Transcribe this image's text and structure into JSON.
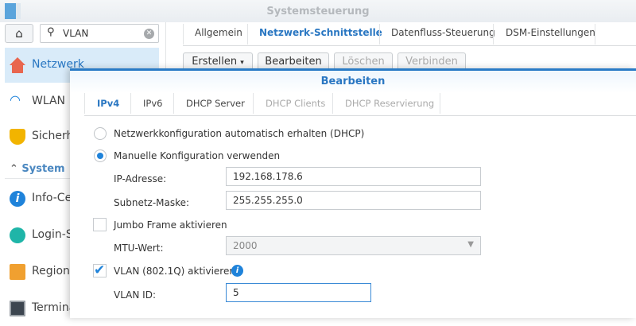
{
  "window": {
    "title": "Systemsteuerung"
  },
  "sidebar": {
    "search_value": "VLAN",
    "items": [
      {
        "label": "Netzwerk",
        "icon": "house-network-icon"
      },
      {
        "label": "WLAN",
        "icon": "wifi-icon"
      },
      {
        "label": "Sicherh",
        "icon": "shield-icon"
      }
    ],
    "section": "System",
    "system_items": [
      {
        "label": "Info-Ce",
        "icon": "info-icon"
      },
      {
        "label": "Login-S",
        "icon": "palette-icon"
      },
      {
        "label": "Regiona",
        "icon": "map-clock-icon"
      },
      {
        "label": "Termina",
        "icon": "terminal-icon"
      }
    ]
  },
  "main": {
    "tabs": [
      "Allgemein",
      "Netzwerk-Schnittstelle",
      "Datenfluss-Steuerung",
      "DSM-Einstellungen"
    ],
    "toolbar": {
      "create": "Erstellen",
      "edit": "Bearbeiten",
      "delete": "Löschen",
      "connect": "Verbinden"
    }
  },
  "dialog": {
    "title": "Bearbeiten",
    "tabs": [
      "IPv4",
      "IPv6",
      "DHCP Server",
      "DHCP Clients",
      "DHCP Reservierung"
    ],
    "dhcp_label": "Netzwerkkonfiguration automatisch erhalten (DHCP)",
    "manual_label": "Manuelle Konfiguration verwenden",
    "ip_label": "IP-Adresse:",
    "ip_value": "192.168.178.6",
    "mask_label": "Subnetz-Maske:",
    "mask_value": "255.255.255.0",
    "jumbo_label": "Jumbo Frame aktivieren",
    "mtu_label": "MTU-Wert:",
    "mtu_value": "2000",
    "vlan_label": "VLAN (802.1Q) aktivieren",
    "vlan_id_label": "VLAN ID:",
    "vlan_id_value": "5"
  },
  "colors": {
    "accent": "#2a77c2",
    "selected_bg": "#d9ebf9"
  }
}
